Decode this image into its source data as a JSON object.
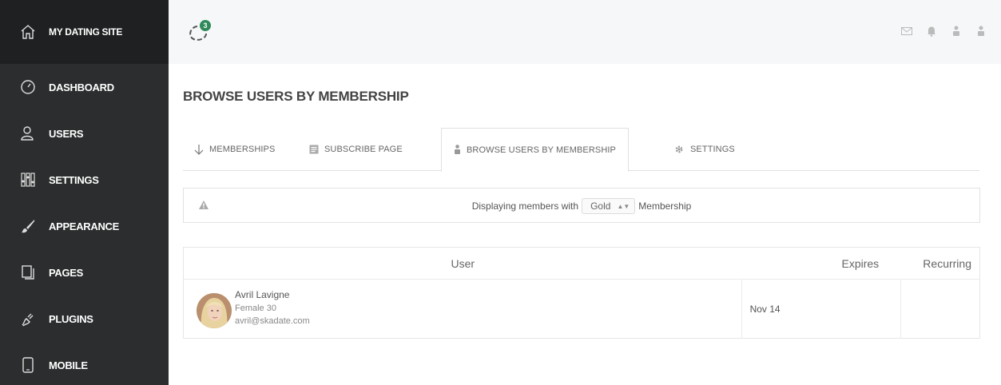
{
  "sidebar": {
    "site_name": "MY DATING SITE",
    "items": [
      {
        "label": "DASHBOARD",
        "icon": "gauge-icon"
      },
      {
        "label": "USERS",
        "icon": "users-icon"
      },
      {
        "label": "SETTINGS",
        "icon": "sliders-icon"
      },
      {
        "label": "APPEARANCE",
        "icon": "brush-icon"
      },
      {
        "label": "PAGES",
        "icon": "pages-icon"
      },
      {
        "label": "PLUGINS",
        "icon": "plug-icon"
      },
      {
        "label": "MOBILE",
        "icon": "mobile-icon"
      }
    ]
  },
  "topbar": {
    "notification_count": "3",
    "icons": [
      "mail-icon",
      "bell-icon",
      "user-icon",
      "user-icon"
    ]
  },
  "page": {
    "title": "BROWSE USERS BY MEMBERSHIP"
  },
  "tabs": [
    {
      "label": "MEMBERSHIPS",
      "icon": "arrow-down-icon"
    },
    {
      "label": "SUBSCRIBE PAGE",
      "icon": "subscribe-page-icon"
    },
    {
      "label": "BROWSE USERS BY MEMBERSHIP",
      "icon": "user-icon",
      "active": true
    },
    {
      "label": "SETTINGS",
      "icon": "gear-icon"
    }
  ],
  "notice": {
    "prefix": "Displaying members with",
    "selected": "Gold",
    "suffix": "Membership"
  },
  "table": {
    "headers": {
      "user": "User",
      "expires": "Expires",
      "recurring": "Recurring"
    },
    "rows": [
      {
        "name": "Avril Lavigne",
        "gender_age": "Female 30",
        "email": "avril@skadate.com",
        "expires": "Nov 14",
        "recurring": ""
      }
    ]
  },
  "colors": {
    "sidebar_bg": "#2b2d2e",
    "sidebar_head_bg": "#1f2021",
    "badge": "#2f8a5a"
  }
}
